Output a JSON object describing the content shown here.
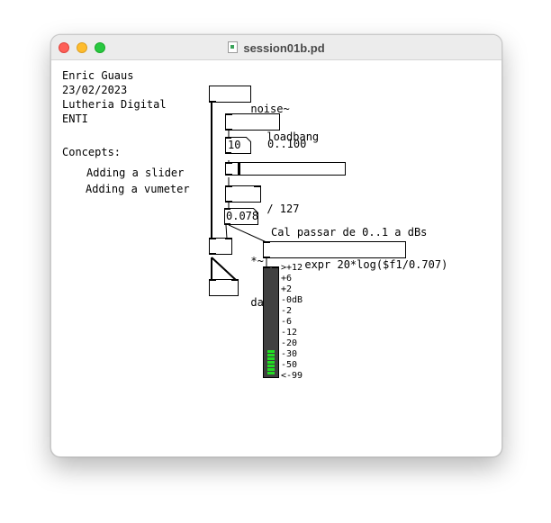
{
  "window": {
    "title": "session01b.pd",
    "doc_icon": "pd-document-icon"
  },
  "comments": {
    "author": "Enric Guaus",
    "date": "23/02/2023",
    "course": "Lutheria Digital",
    "school": "ENTI",
    "concepts_heading": "Concepts:",
    "concept1": "Adding a slider",
    "concept2": "Adding a vumeter",
    "range_note": "0..100",
    "conversion_note": "Cal passar de 0..1 a dBs"
  },
  "objects": {
    "noise": "noise~",
    "loadbang": "loadbang",
    "number": "10",
    "divide": "/ 127",
    "float_box": "0.078",
    "multiply": "*~",
    "dac": "dac~",
    "expr": "expr 20*log($f1/0.707)"
  },
  "slider": {
    "value_fraction": 0.1,
    "min": 0,
    "max": 127
  },
  "vumeter": {
    "scale": [
      ">+12",
      "+6",
      "+2",
      "-0dB",
      "-2",
      "-6",
      "-12",
      "-20",
      "-30",
      "-50",
      "<-99"
    ],
    "lit_segments": 7,
    "lit_color": "#22dd22",
    "body_color": "#404040"
  }
}
